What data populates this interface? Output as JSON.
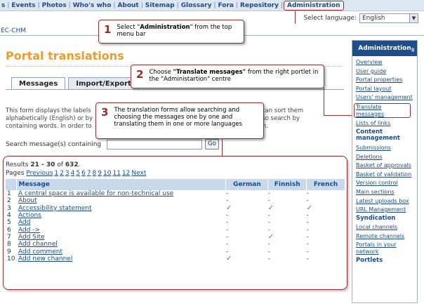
{
  "topnav": {
    "items": [
      "Events",
      "Photos",
      "Who's who",
      "About",
      "Sitemap",
      "Glossary",
      "Fora",
      "Repository",
      "Administration"
    ],
    "first_prefix": "s"
  },
  "language": {
    "label": "Select language:",
    "value": "English"
  },
  "breadcrumb": "EC-CHM",
  "page_title": "Portal translations",
  "tabs": [
    "Messages",
    "Import/Export"
  ],
  "description": {
    "line1": "This form displays the labels",
    "line1_end": "ou can sort them",
    "line2": "alphabetically (English) or by",
    "line2_end": "and also search by",
    "line3": "containing words. In order to",
    "line3_end": "English."
  },
  "search": {
    "label": "Search message(s) containing",
    "value": "",
    "button": "Go"
  },
  "results": {
    "prefix": "Results ",
    "range": "21 - 30",
    "of": " of ",
    "total": "632",
    "suffix": "."
  },
  "pager": {
    "label": "Pages",
    "previous": "Previous",
    "pages": [
      "1",
      "2",
      "3",
      "4",
      "5",
      "6",
      "7",
      "8",
      "9",
      "10",
      "11",
      "12"
    ],
    "next": "Next"
  },
  "table": {
    "headers": {
      "message": "Message",
      "german": "German",
      "finnish": "Finnish",
      "french": "French"
    },
    "rows": [
      {
        "n": "1",
        "msg": "A central space is available for non-technical use",
        "de": "-",
        "fi": "-",
        "fr": "-"
      },
      {
        "n": "2",
        "msg": "About",
        "de": "-",
        "fi": "-",
        "fr": "-"
      },
      {
        "n": "3",
        "msg": "Accessibility statement",
        "de": "✓",
        "fi": "✓",
        "fr": "✓"
      },
      {
        "n": "4",
        "msg": "Actions",
        "de": "-",
        "fi": "-",
        "fr": "-"
      },
      {
        "n": "5",
        "msg": "Add",
        "de": "-",
        "fi": "-",
        "fr": "-"
      },
      {
        "n": "6",
        "msg": "Add ->",
        "de": "-",
        "fi": "-",
        "fr": "-"
      },
      {
        "n": "7",
        "msg": "Add Site",
        "de": "-",
        "fi": "✓",
        "fr": "-"
      },
      {
        "n": "8",
        "msg": "Add channel",
        "de": "-",
        "fi": "-",
        "fr": "-"
      },
      {
        "n": "9",
        "msg": "Add comment",
        "de": "-",
        "fi": "-",
        "fr": "-"
      },
      {
        "n": "10",
        "msg": "Add new channel",
        "de": "✓",
        "fi": "-",
        "fr": "-"
      }
    ]
  },
  "portlet": {
    "title": "Administration",
    "items": [
      {
        "label": "Overview",
        "type": "link"
      },
      {
        "label": "User guide",
        "type": "link"
      },
      {
        "label": "Portal properties",
        "type": "link"
      },
      {
        "label": "Portal layout",
        "type": "link"
      },
      {
        "label": "Users' management",
        "type": "link"
      },
      {
        "label": "Translate messages",
        "type": "highlight"
      },
      {
        "label": "Lists of links",
        "type": "link"
      },
      {
        "label": "Content management",
        "type": "section"
      },
      {
        "label": "Submissions",
        "type": "link"
      },
      {
        "label": "Deletions",
        "type": "link"
      },
      {
        "label": "Basket of approvals",
        "type": "link"
      },
      {
        "label": "Basket of validation",
        "type": "link"
      },
      {
        "label": "Version control",
        "type": "link"
      },
      {
        "label": "Main sections",
        "type": "link"
      },
      {
        "label": "Latest uploads box",
        "type": "link"
      },
      {
        "label": "URL Management",
        "type": "link"
      },
      {
        "label": "Syndication",
        "type": "section"
      },
      {
        "label": "Local channels",
        "type": "link"
      },
      {
        "label": "Remote channels",
        "type": "link"
      },
      {
        "label": "Portals in your network",
        "type": "link"
      },
      {
        "label": "Portlets",
        "type": "section"
      }
    ]
  },
  "callouts": {
    "c1": {
      "num": "1",
      "pre": "Select \"",
      "bold": "Administration",
      "post": "\" from the top menu bar"
    },
    "c2": {
      "num": "2",
      "pre": "Choose ",
      "bold": "\"Translate messages\"",
      "post": " from the right portlet in the \"Administartion\" centre"
    },
    "c3": {
      "num": "3",
      "text": "The translation forms allow  searching and choosing the messages one by one and translating them in one or more languages"
    }
  },
  "colors": {
    "accent": "#9e2a2a",
    "title": "#f19a2b",
    "nav": "#1b4b8a",
    "portlet_head": "#1f4e8c",
    "check": "#3a9a22"
  }
}
